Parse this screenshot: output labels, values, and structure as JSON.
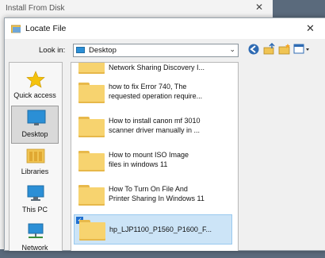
{
  "background_dialog": {
    "title": "Install From Disk",
    "close_glyph": "✕"
  },
  "dialog": {
    "title": "Locate File",
    "close_glyph": "✕"
  },
  "toolbar": {
    "look_in_label": "Look in:",
    "look_in_value": "Desktop",
    "buttons": [
      "back-icon",
      "up-folder-icon",
      "new-folder-icon",
      "view-menu-icon"
    ]
  },
  "places": [
    {
      "label": "Quick access",
      "icon": "star-icon"
    },
    {
      "label": "Desktop",
      "icon": "desktop-icon",
      "selected": true
    },
    {
      "label": "Libraries",
      "icon": "libraries-icon"
    },
    {
      "label": "This PC",
      "icon": "this-pc-icon"
    },
    {
      "label": "Network",
      "icon": "network-icon"
    }
  ],
  "files": [
    {
      "line1": "Network Sharing Discovery I..."
    },
    {
      "line1": "how to fix Error 740, The",
      "line2": "requested operation require..."
    },
    {
      "line1": "How to install canon mf 3010",
      "line2": "scanner driver manually in ..."
    },
    {
      "line1": "How to mount ISO Image",
      "line2": "files in windows 11"
    },
    {
      "line1": "How To Turn On File And",
      "line2": "Printer Sharing In Windows 11"
    },
    {
      "line1": "hp_LJP1100_P1560_P1600_F...",
      "selected": true
    }
  ],
  "colors": {
    "accent": "#1e6fd0",
    "selection": "#cce4f7",
    "folder": "#f7d36f"
  }
}
